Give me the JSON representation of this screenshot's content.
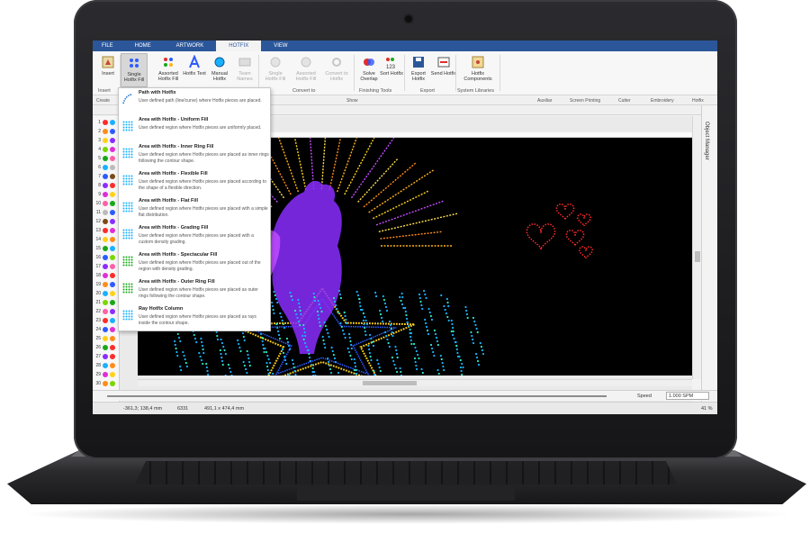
{
  "ribbon_tabs": [
    "FILE",
    "HOME",
    "ARTWORK",
    "HOTFIX",
    "VIEW"
  ],
  "ribbon_buttons": {
    "insert": "Insert",
    "single_hotfix_fill": "Single Hotfix Fill",
    "assorted_hotfix_fill": "Assorted Hotfix Fill",
    "hotfix_text": "Hotfix Text",
    "manual_hotfix": "Manual Hotfix",
    "team_names": "Team Names",
    "single_hotfix_fill_2": "Single Hotfix Fill",
    "assorted_hotfix_fill_2": "Assorted Hotfix Fill",
    "convert_to_hotfix": "Convert to Hotfix",
    "solve_overlap": "Solve Overlap",
    "sort_hotfix": "Sort Hotfix",
    "export_hotfix": "Export Hotfix",
    "send_hotfix": "Send Hotfix",
    "hotfix_components": "Hotfix Components"
  },
  "ribbon_groups": [
    "Insert",
    "Convert to",
    "Finishing Tools",
    "Export",
    "System Libraries"
  ],
  "toolbar2": {
    "create": "Create",
    "show": "Show",
    "auxiliar": "Auxiliar",
    "screen_printing": "Screen Printing",
    "cutter": "Cutter",
    "embroidery": "Embroidery",
    "hotfix": "Hotfix"
  },
  "dropdown_items": [
    {
      "title": "Path with Hotfix",
      "desc": "User defined path (line/curve) where Hotfix pieces are placed."
    },
    {
      "title": "Area with Hotfix - Uniform Fill",
      "desc": "User defined region where Hotfix pieces are uniformly placed."
    },
    {
      "title": "Area with Hotfix - Inner Ring Fill",
      "desc": "User defined region where Hotfix pieces are placed as inner rings following the contour shape."
    },
    {
      "title": "Area with Hotfix - Flexible Fill",
      "desc": "User defined region where Hotfix pieces are placed according to the shape of a flexible direction."
    },
    {
      "title": "Area with Hotfix - Flat Fill",
      "desc": "User defined region where Hotfix pieces are placed with a simple flat distribution."
    },
    {
      "title": "Area with Hotfix - Grading Fill",
      "desc": "User defined region where Hotfix pieces are placed with a custom density grading."
    },
    {
      "title": "Area with Hotfix - Spectacular Fill",
      "desc": "User defined region where Hotfix pieces are placed out of the region with density grading."
    },
    {
      "title": "Area with Hotfix - Outer Ring Fill",
      "desc": "User defined region where Hotfix pieces are placed as outer rings following the contour shape."
    },
    {
      "title": "Ray Hotfix Column",
      "desc": "User defined region where Hotfix pieces are placed as rays inside the contour shape."
    }
  ],
  "palette_numbers": [
    "1",
    "2",
    "3",
    "4",
    "5",
    "6",
    "7",
    "8",
    "9",
    "10",
    "11",
    "12",
    "13",
    "14",
    "15",
    "16",
    "17",
    "18",
    "19",
    "20",
    "21",
    "22",
    "23",
    "24",
    "25",
    "26",
    "27",
    "28",
    "29",
    "30",
    "31"
  ],
  "palette_colors": [
    "#ff2b2b",
    "#ff8c1a",
    "#ffd21a",
    "#7bd600",
    "#18a818",
    "#1ab0ff",
    "#2d5bff",
    "#8a2dff",
    "#e02dd8",
    "#ff5fa8",
    "#bbbbbb",
    "#7a4a1a",
    "#ff2b2b",
    "#ffd21a",
    "#18a818",
    "#2d5bff",
    "#8a2dff",
    "#e02dd8",
    "#ff8c1a",
    "#1ab0ff",
    "#7bd600",
    "#ff5fa8",
    "#ff2b2b",
    "#2d5bff",
    "#ffd21a",
    "#18a818",
    "#8a2dff",
    "#1ab0ff",
    "#e02dd8",
    "#ff8c1a",
    "#ff2b2b"
  ],
  "side_panel_label": "Object Manager",
  "playbar": {
    "speed_label": "Speed",
    "speed_value": "1.000 SPM"
  },
  "status": {
    "coords": "-361,3; 138,4 mm",
    "count": "6331",
    "size": "491,1 x 474,4 mm",
    "zoom": "41 %"
  }
}
